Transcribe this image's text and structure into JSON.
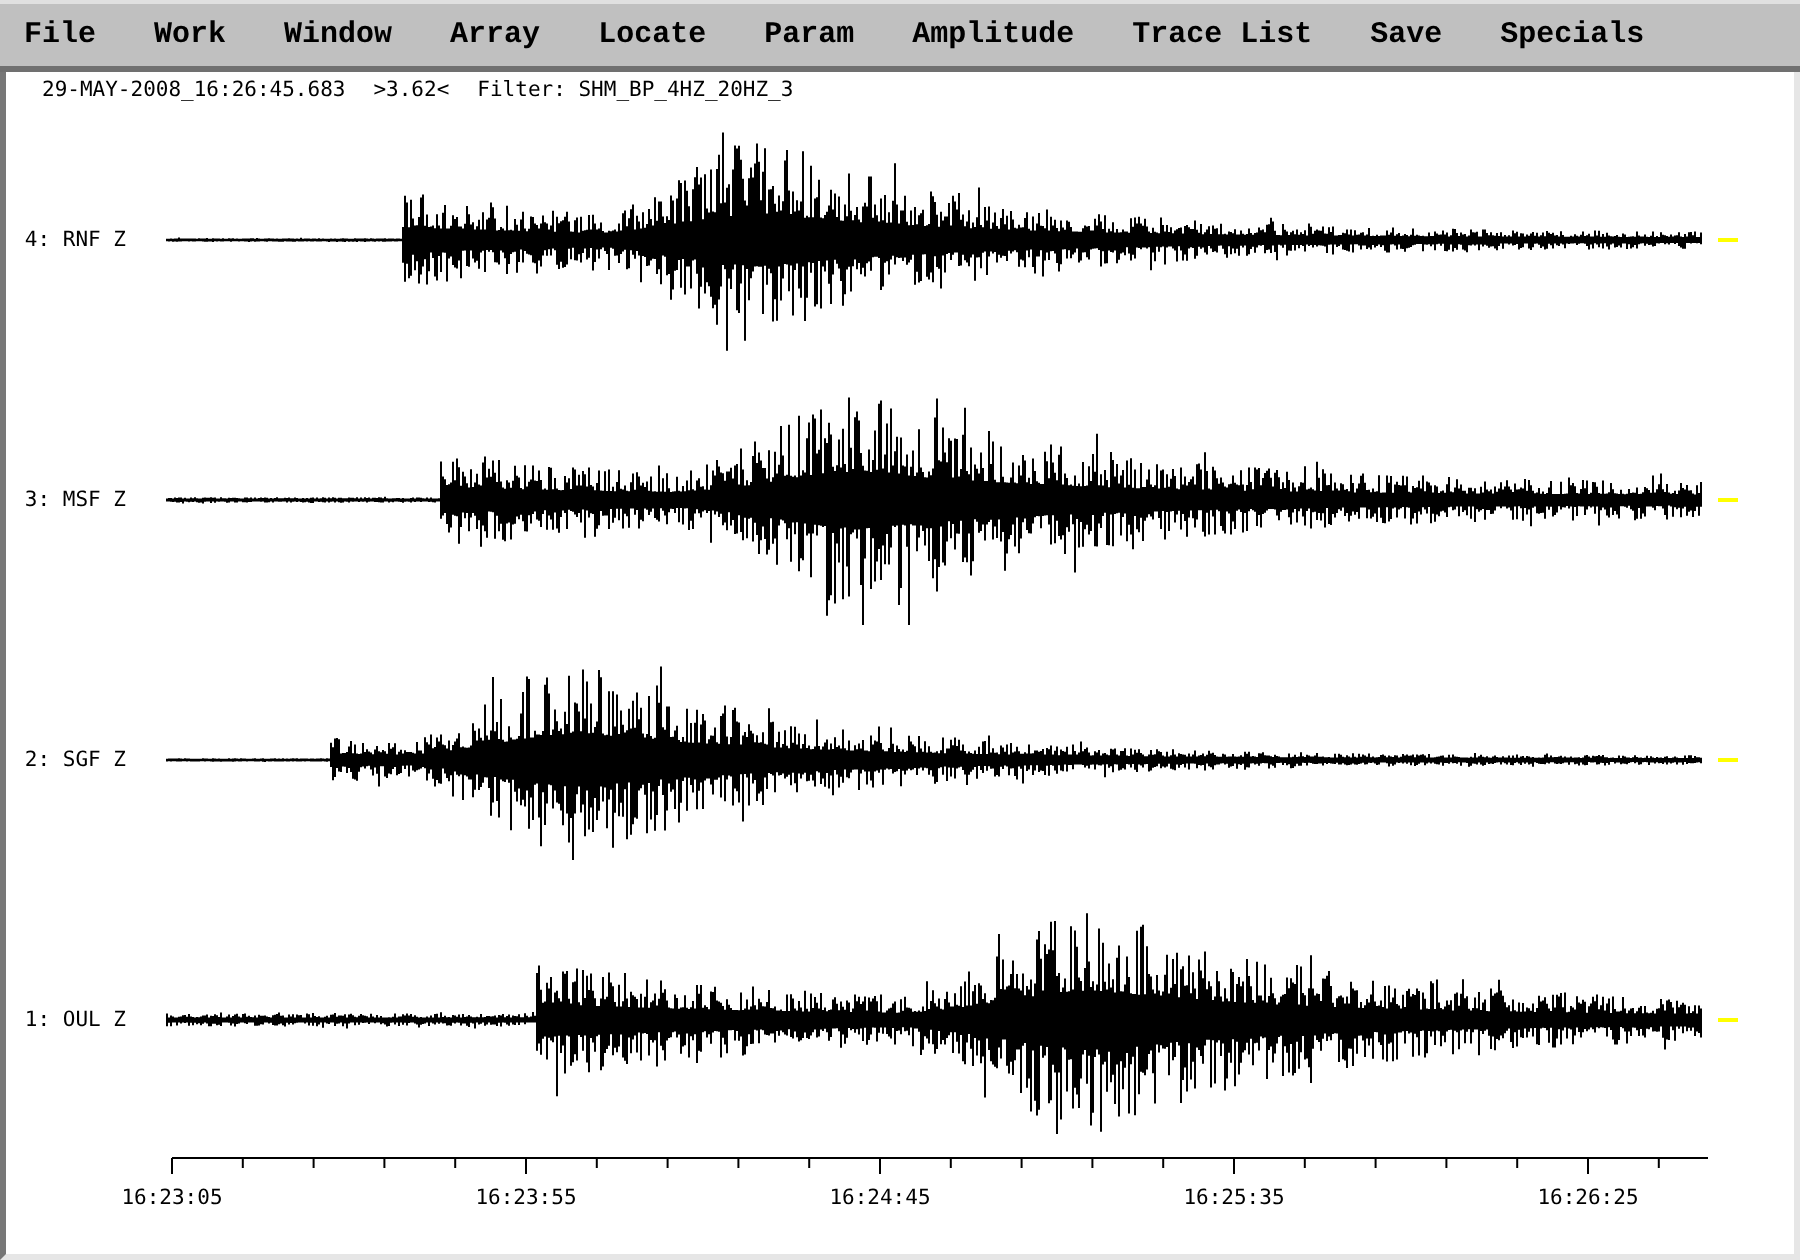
{
  "menu": [
    {
      "label": "File"
    },
    {
      "label": "Work"
    },
    {
      "label": "Window"
    },
    {
      "label": "Array"
    },
    {
      "label": "Locate"
    },
    {
      "label": "Param"
    },
    {
      "label": "Amplitude"
    },
    {
      "label": "Trace List"
    },
    {
      "label": "Save"
    },
    {
      "label": "Specials"
    }
  ],
  "header": {
    "time": "29-MAY-2008_16:26:45.683",
    "scale": ">3.62<",
    "filter": "Filter: SHM_BP_4HZ_20HZ_3"
  },
  "traces": [
    {
      "label": "4: RNF Z"
    },
    {
      "label": "3: MSF Z"
    },
    {
      "label": "2: SGF Z"
    },
    {
      "label": "1: OUL Z"
    }
  ],
  "time_axis": {
    "labels": [
      "16:23:05",
      "16:23:55",
      "16:24:45",
      "16:25:35",
      "16:26:25"
    ]
  }
}
